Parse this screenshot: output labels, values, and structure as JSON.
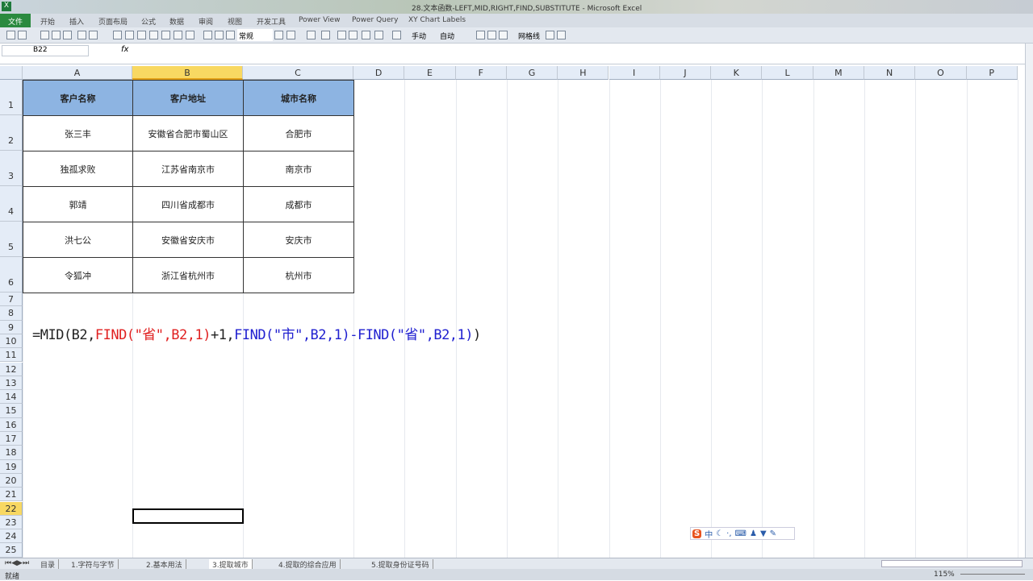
{
  "window": {
    "title": "28.文本函数-LEFT,MID,RIGHT,FIND,SUBSTITUTE  -  Microsoft Excel"
  },
  "ribbon_tabs": [
    "文件",
    "开始",
    "插入",
    "页面布局",
    "公式",
    "数据",
    "审阅",
    "视图",
    "开发工具",
    "Power View",
    "Power Query",
    "XY Chart Labels"
  ],
  "toolbar": {
    "number_format": "常规",
    "wrap": "手动",
    "auto": "自动",
    "gridlines": "网格线"
  },
  "formula_bar": {
    "name_box": "B22",
    "fx": "fx",
    "value": ""
  },
  "columns": [
    "A",
    "B",
    "C",
    "D",
    "E",
    "F",
    "G",
    "H",
    "I",
    "J",
    "K",
    "L",
    "M",
    "N",
    "O",
    "P"
  ],
  "rows": [
    "1",
    "2",
    "3",
    "4",
    "5",
    "6",
    "7",
    "8",
    "9",
    "10",
    "11",
    "12",
    "13",
    "14",
    "15",
    "16",
    "17",
    "18",
    "19",
    "20",
    "21",
    "22",
    "23",
    "24",
    "25"
  ],
  "table": {
    "headers": [
      "客户名称",
      "客户地址",
      "城市名称"
    ],
    "rows": [
      [
        "张三丰",
        "安徽省合肥市蜀山区",
        "合肥市"
      ],
      [
        "独孤求败",
        "江苏省南京市",
        "南京市"
      ],
      [
        "郭靖",
        "四川省成都市",
        "成都市"
      ],
      [
        "洪七公",
        "安徽省安庆市",
        "安庆市"
      ],
      [
        "令狐冲",
        "浙江省杭州市",
        "杭州市"
      ]
    ]
  },
  "formula": {
    "p1": "=MID(B2,",
    "p2": "FIND(\"省\",B2,1)",
    "p3": "+1,",
    "p4": "FIND(\"市\",B2,1)-FIND(\"省\",B2,1)",
    "p5": ")"
  },
  "formula_colors": {
    "black": "#222222",
    "red": "#e02020",
    "blue": "#2020d0"
  },
  "sheet_tabs": [
    {
      "label": "目录"
    },
    {
      "label": "1.字符与字节"
    },
    {
      "label": "2.基本用法"
    },
    {
      "label": "3.提取城市",
      "active": true
    },
    {
      "label": "4.提取的综合应用"
    },
    {
      "label": "5.提取身份证号码"
    }
  ],
  "status": {
    "ready": "就绪",
    "zoom": "115%"
  },
  "ime": {
    "mode": "中"
  }
}
